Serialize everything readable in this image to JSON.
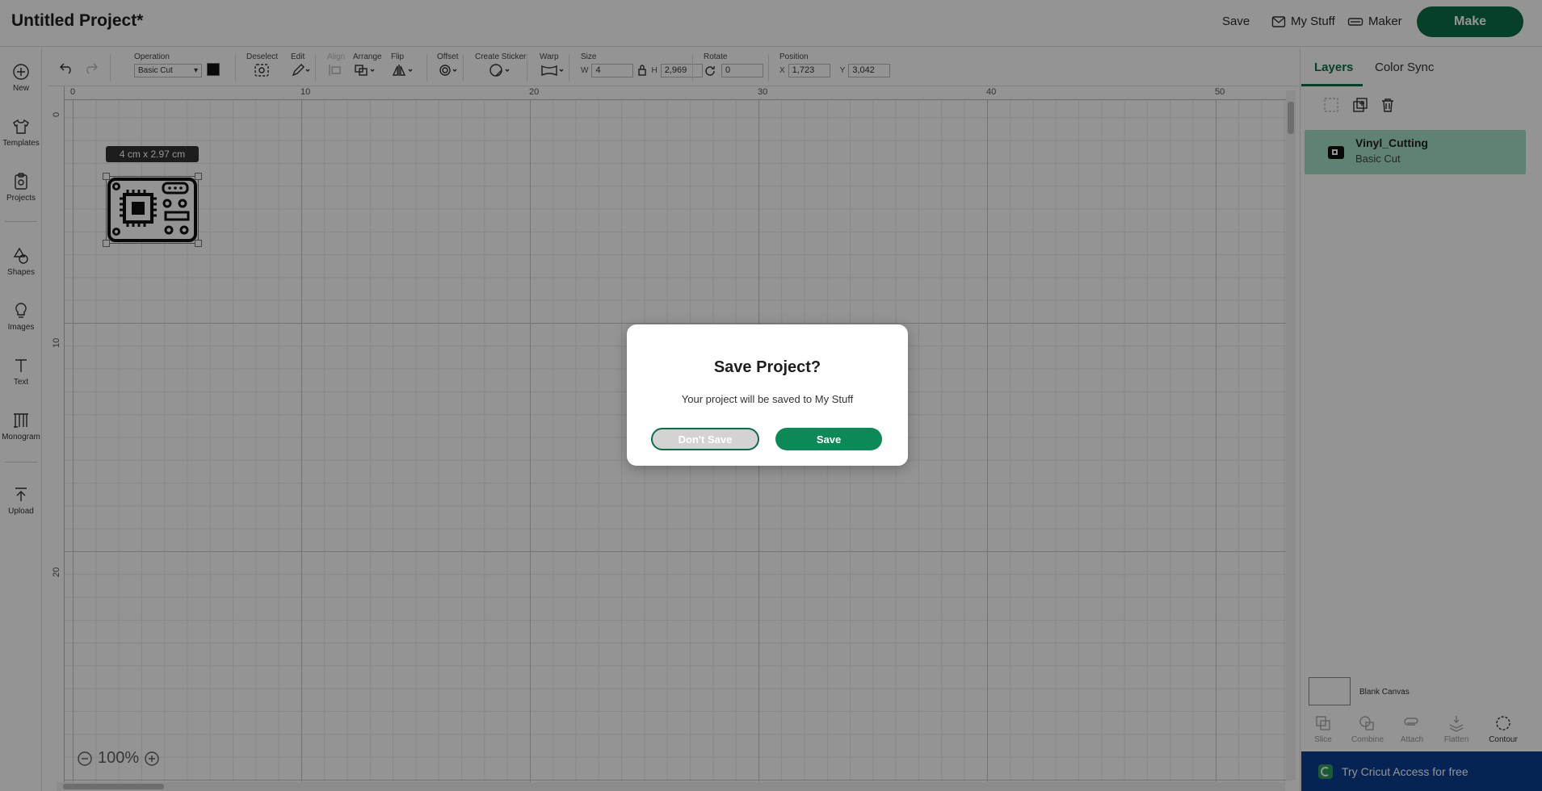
{
  "header": {
    "title": "Untitled Project*",
    "save_label": "Save",
    "my_stuff_label": "My Stuff",
    "maker_label": "Maker",
    "make_label": "Make"
  },
  "sidebar": {
    "items": [
      {
        "label": "New",
        "icon": "plus-circle-icon"
      },
      {
        "label": "Templates",
        "icon": "tshirt-icon"
      },
      {
        "label": "Projects",
        "icon": "clipboard-icon"
      },
      {
        "label": "Shapes",
        "icon": "shapes-icon"
      },
      {
        "label": "Images",
        "icon": "bulb-icon"
      },
      {
        "label": "Text",
        "icon": "text-icon"
      },
      {
        "label": "Monogram",
        "icon": "monogram-icon"
      },
      {
        "label": "Upload",
        "icon": "upload-icon"
      }
    ]
  },
  "toolbar": {
    "operation_label": "Operation",
    "operation_value": "Basic Cut",
    "color": "#000000",
    "deselect_label": "Deselect",
    "edit_label": "Edit",
    "align_label": "Align",
    "arrange_label": "Arrange",
    "flip_label": "Flip",
    "offset_label": "Offset",
    "create_sticker_label": "Create Sticker",
    "warp_label": "Warp",
    "size_label": "Size",
    "w_label": "W",
    "w_value": "4",
    "h_label": "H",
    "h_value": "2,969",
    "rotate_label": "Rotate",
    "rotate_value": "0",
    "position_label": "Position",
    "x_label": "X",
    "x_value": "1,723",
    "y_label": "Y",
    "y_value": "3,042"
  },
  "canvas": {
    "ruler_top": [
      "0",
      "10",
      "20",
      "30",
      "40",
      "50"
    ],
    "ruler_left": [
      "0",
      "10",
      "20"
    ],
    "size_tag": "4  cm x 2.97  cm",
    "zoom": "100%"
  },
  "right_panel": {
    "tabs": [
      "Layers",
      "Color Sync"
    ],
    "layer": {
      "name": "Vinyl_Cutting",
      "operation": "Basic Cut"
    },
    "blank_canvas_label": "Blank Canvas",
    "bottom_tools": [
      "Slice",
      "Combine",
      "Attach",
      "Flatten",
      "Contour"
    ],
    "banner": "Try Cricut Access for free"
  },
  "dialog": {
    "title": "Save Project?",
    "message": "Your project will be saved to My Stuff",
    "dont_save_label": "Don't Save",
    "save_label": "Save"
  },
  "colors": {
    "brand_green": "#0b6e45",
    "layer_highlight": "#a5e0c4",
    "banner_blue": "#0a3e91"
  }
}
